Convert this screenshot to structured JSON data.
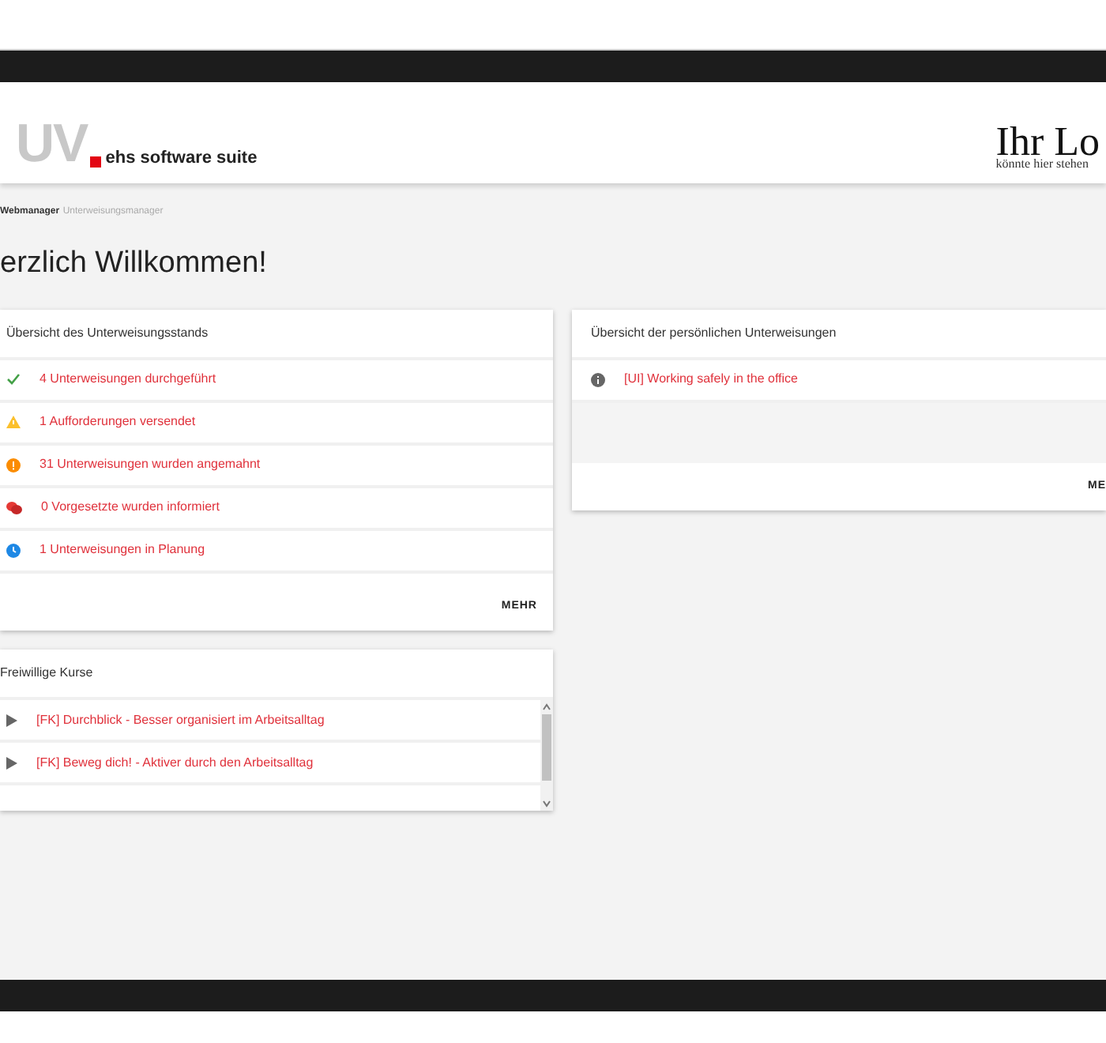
{
  "header": {
    "logo_mark": "UV",
    "logo_text": "ehs software suite",
    "customer_logo": "Ihr Lo",
    "customer_logo_sub": "könnte hier stehen"
  },
  "breadcrumb": [
    {
      "label": "Webmanager",
      "selected": false
    },
    {
      "label": "Unterweisungsmanager",
      "selected": true
    }
  ],
  "title": "erzlich Willkommen!",
  "status_card": {
    "title": "Übersicht des Unterweisungsstands",
    "items": [
      {
        "kind": "done",
        "label": "4 Unterweisungen durchgeführt"
      },
      {
        "kind": "warning",
        "label": "1 Aufforderungen versendet"
      },
      {
        "kind": "overdue",
        "label": "31 Unterweisungen wurden angemahnt"
      },
      {
        "kind": "informed",
        "label": "0 Vorgesetzte wurden informiert"
      },
      {
        "kind": "planned",
        "label": "1 Unterweisungen in Planung"
      }
    ],
    "button": "MEHR"
  },
  "personal_card": {
    "title": "Übersicht der persönlichen Unterweisungen",
    "items": [
      {
        "kind": "info",
        "label": "[UI] Working safely in the office"
      }
    ],
    "button": "ME"
  },
  "courses_card": {
    "title": "Freiwillige Kurse",
    "items": [
      {
        "label": "[FK] Durchblick - Besser organisiert im Arbeitsalltag"
      },
      {
        "label": "[FK] Beweg dich! - Aktiver durch den Arbeitsalltag"
      }
    ]
  }
}
